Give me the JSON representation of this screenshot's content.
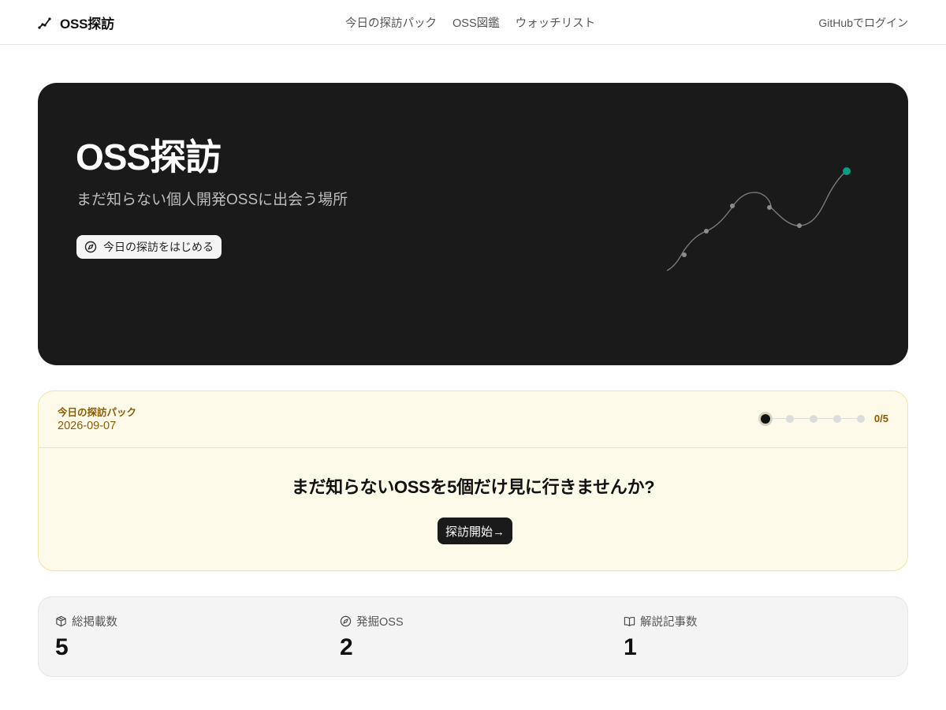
{
  "header": {
    "brand": "OSS探訪",
    "nav": [
      "今日の探訪パック",
      "OSS図鑑",
      "ウォッチリスト"
    ],
    "login": "GitHubでログイン"
  },
  "hero": {
    "title": "OSS探訪",
    "subtitle": "まだ知らない個人開発OSSに出会う場所",
    "button_label": "今日の探訪をはじめる",
    "accent_color": "#0a9b84"
  },
  "pack": {
    "label": "今日の探訪パック",
    "date": "2026-09-07",
    "progress_current": 0,
    "progress_total": 5,
    "progress_text": "0/5",
    "question": "まだ知らないOSSを5個だけ見に行きませんか?",
    "start_label": "探訪開始→"
  },
  "stats": [
    {
      "icon": "box-icon",
      "label": "総掲載数",
      "value": "5"
    },
    {
      "icon": "compass-icon",
      "label": "発掘OSS",
      "value": "2"
    },
    {
      "icon": "book-icon",
      "label": "解説記事数",
      "value": "1"
    }
  ]
}
